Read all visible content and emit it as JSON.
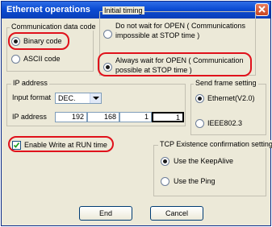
{
  "window": {
    "title": "Ethernet operations"
  },
  "communication_data_code": {
    "legend": "Communication data code",
    "options": [
      {
        "label": "Binary code",
        "selected": true
      },
      {
        "label": "ASCII code",
        "selected": false
      }
    ]
  },
  "initial_timing": {
    "legend": "Initial timing",
    "options": [
      {
        "line1": "Do not wait for OPEN ( Communications",
        "line2": "impossible at STOP time )",
        "selected": false
      },
      {
        "line1": "Always wait for OPEN ( Communication",
        "line2": "possible at STOP time )",
        "selected": true
      }
    ]
  },
  "ip_address": {
    "legend": "IP address",
    "input_format_label": "Input format",
    "input_format_value": "DEC.",
    "ip_label": "IP address",
    "octets": [
      "192",
      "168",
      "1",
      "1"
    ]
  },
  "send_frame": {
    "legend": "Send frame setting",
    "options": [
      {
        "label": "Ethernet(V2.0)",
        "selected": true
      },
      {
        "label": "IEEE802.3",
        "selected": false
      }
    ]
  },
  "run_time": {
    "label": "Enable Write at RUN time",
    "checked": true
  },
  "tcp_existence": {
    "legend": "TCP Existence confirmation setting",
    "options": [
      {
        "label": "Use the KeepAlive",
        "selected": true
      },
      {
        "label": "Use the Ping",
        "selected": false
      }
    ]
  },
  "buttons": {
    "end": "End",
    "cancel": "Cancel"
  },
  "colors": {
    "titlebar": "#0b4bd3",
    "highlight": "#e0111b",
    "dialog_bg": "#ece9d8"
  }
}
